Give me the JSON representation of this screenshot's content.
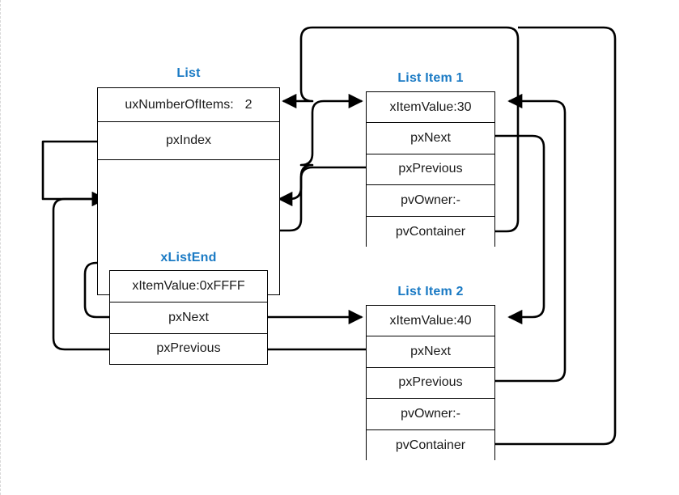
{
  "diagram": {
    "title_color": "#1a7ac4",
    "line_color": "#000000",
    "background": "#ffffff",
    "type": "freertos-doubly-linked-list"
  },
  "list": {
    "title": "List",
    "fields": [
      {
        "label": "uxNumberOfItems:",
        "value": "2"
      },
      {
        "label": "pxIndex",
        "value": ""
      }
    ],
    "xlistend": {
      "title": "xListEnd",
      "fields": [
        {
          "label": "xItemValue:0xFFFF"
        },
        {
          "label": "pxNext"
        },
        {
          "label": "pxPrevious"
        }
      ]
    }
  },
  "item1": {
    "title": "List Item 1",
    "fields": [
      {
        "label": "xItemValue:30"
      },
      {
        "label": "pxNext"
      },
      {
        "label": "pxPrevious"
      },
      {
        "label": "pvOwner:-"
      },
      {
        "label": "pvContainer"
      }
    ]
  },
  "item2": {
    "title": "List Item 2",
    "fields": [
      {
        "label": "xItemValue:40"
      },
      {
        "label": "pxNext"
      },
      {
        "label": "pxPrevious"
      },
      {
        "label": "pvOwner:-"
      },
      {
        "label": "pvContainer"
      }
    ]
  },
  "connections": [
    {
      "name": "item1-pvContainer-to-list",
      "from": "item1.pvContainer",
      "to": "list.uxNumberOfItems"
    },
    {
      "name": "item2-pvContainer-to-list",
      "from": "item2.pvContainer",
      "to": "list.uxNumberOfItems"
    },
    {
      "name": "list-pxIndex-to-xlistend",
      "from": "list.pxIndex",
      "to": "list.xListEnd.xItemValue"
    },
    {
      "name": "xlistend-pxNext-to-item1",
      "from": "list.xListEnd.pxNext",
      "to": "item1.xItemValue"
    },
    {
      "name": "item1-pxPrevious-to-xlistend",
      "from": "item1.pxPrevious",
      "to": "list.xListEnd.xItemValue"
    },
    {
      "name": "item1-pxNext-to-item2",
      "from": "item1.pxNext",
      "to": "item2.xItemValue"
    },
    {
      "name": "item2-pxPrevious-to-item1",
      "from": "item2.pxPrevious",
      "to": "item1.xItemValue"
    },
    {
      "name": "xlistend-pxPrevious-to-item2",
      "from": "list.xListEnd.pxPrevious",
      "to": "item2.xItemValue"
    },
    {
      "name": "item2-pxNext-to-xlistend",
      "from": "item2.pxNext",
      "to": "list.xListEnd.xItemValue"
    }
  ]
}
